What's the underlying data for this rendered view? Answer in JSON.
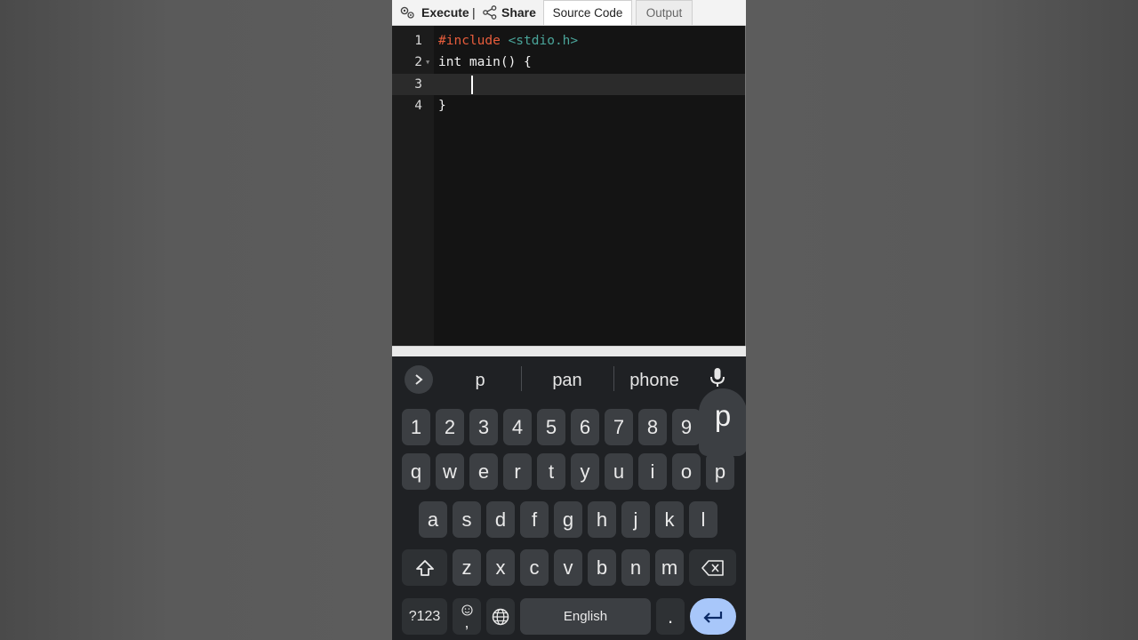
{
  "toolbar": {
    "execute_label": "Execute",
    "separator": "|",
    "share_label": "Share",
    "tabs": [
      {
        "label": "Source Code",
        "active": true
      },
      {
        "label": "Output",
        "active": false
      }
    ]
  },
  "editor": {
    "current_line": 3,
    "lines": [
      {
        "num": "1",
        "tokens": [
          {
            "text": "#include ",
            "cls": "kw-inc"
          },
          {
            "text": "<stdio.h>",
            "cls": "kw-hdr"
          }
        ]
      },
      {
        "num": "2",
        "foldable": true,
        "tokens": [
          {
            "text": "int main() {",
            "cls": ""
          }
        ]
      },
      {
        "num": "3",
        "tokens": []
      },
      {
        "num": "4",
        "tokens": [
          {
            "text": "}",
            "cls": ""
          }
        ]
      }
    ]
  },
  "keyboard": {
    "suggestions": [
      "p",
      "pan",
      "phone"
    ],
    "number_row": [
      "1",
      "2",
      "3",
      "4",
      "5",
      "6",
      "7",
      "8",
      "9"
    ],
    "row1": [
      "q",
      "w",
      "e",
      "r",
      "t",
      "y",
      "u",
      "i",
      "o",
      "p"
    ],
    "row2": [
      "a",
      "s",
      "d",
      "f",
      "g",
      "h",
      "j",
      "k",
      "l"
    ],
    "row3": [
      "z",
      "x",
      "c",
      "v",
      "b",
      "n",
      "m"
    ],
    "symbols_label": "?123",
    "emoji_comma_label": ",",
    "space_label": "English",
    "period_label": ".",
    "popup_key": "p"
  },
  "colors": {
    "include_keyword": "#e85d3c",
    "header_name": "#4aa59a",
    "enter_key": "#a8c7fa",
    "keyboard_bg": "#1f2124"
  }
}
